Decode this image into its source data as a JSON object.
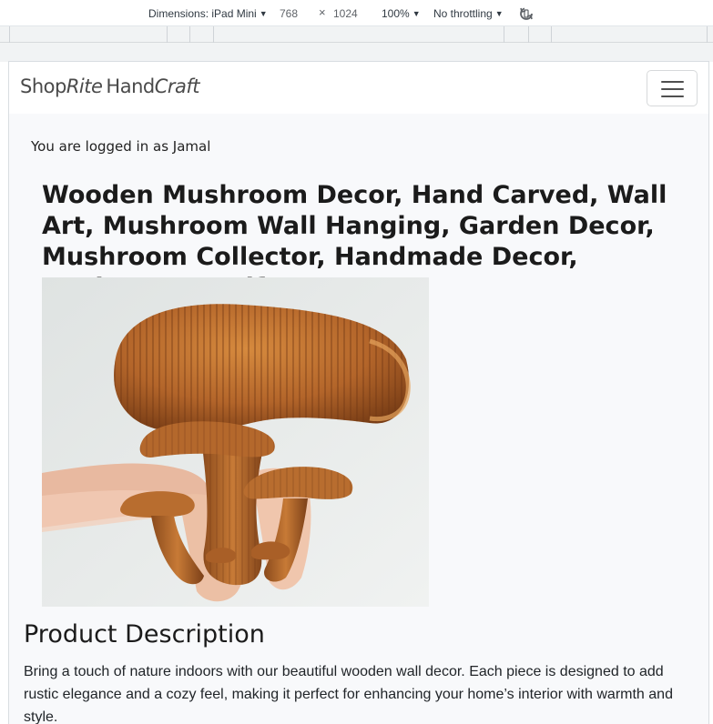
{
  "devtools": {
    "dimensions_label": "Dimensions: iPad Mini",
    "width": "768",
    "times": "×",
    "height": "1024",
    "zoom": "100%",
    "throttling": "No throttling",
    "rotate_icon": "rotate-icon"
  },
  "navbar": {
    "brand": {
      "part1": "Shop",
      "part2": "Rite",
      "part3": "Hand",
      "part4": "Craft"
    },
    "toggler_icon": "hamburger-icon"
  },
  "session": {
    "logged_in_text": "You are logged in as Jamal"
  },
  "product": {
    "title": "Wooden Mushroom Decor, Hand Carved, Wall Art, Mushroom Wall Hanging, Garden Decor, Mushroom Collector, Handmade Decor, Mothers Day Gift",
    "image_icon": "carved-mushroom-image"
  },
  "description": {
    "heading": "Product Description",
    "text": "Bring a touch of nature indoors with our beautiful wooden wall decor. Each piece is designed to add rustic elegance and a cozy feel, making it perfect for enhancing your home’s interior with warmth and style."
  }
}
